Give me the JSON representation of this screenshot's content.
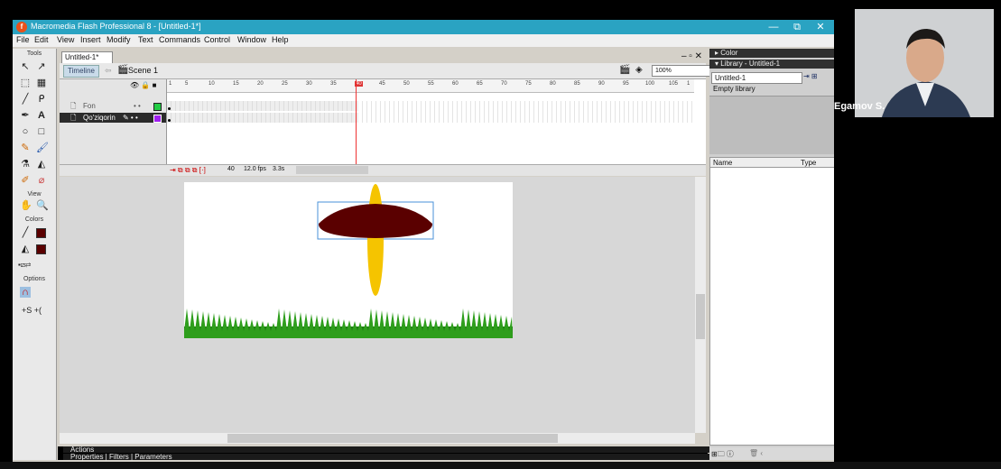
{
  "window": {
    "title": "Macromedia Flash Professional 8 - [Untitled-1*]",
    "controls": [
      "—",
      "⧉",
      "✕"
    ]
  },
  "menu": [
    "File",
    "Edit",
    "View",
    "Insert",
    "Modify",
    "Text",
    "Commands",
    "Control",
    "Window",
    "Help"
  ],
  "tools": {
    "title": "Tools",
    "view_label": "View",
    "colors_label": "Colors",
    "options_label": "Options"
  },
  "document": {
    "tab": "Untitled-1*",
    "timeline_button": "Timeline",
    "scene": "Scene 1",
    "zoom": "100%"
  },
  "timeline": {
    "frame_numbers": [
      "1",
      "5",
      "10",
      "15",
      "20",
      "25",
      "30",
      "35",
      "40",
      "45",
      "50",
      "55",
      "60",
      "65",
      "70",
      "75",
      "80",
      "85",
      "90",
      "95",
      "100",
      "105",
      "1"
    ],
    "layers": [
      {
        "name": "Fon",
        "color": "#22cc44",
        "selected": false
      },
      {
        "name": "Qo'ziqorin",
        "color": "#a020f0",
        "selected": true
      }
    ],
    "current_frame": "40",
    "fps": "12.0 fps",
    "time": "3.3s"
  },
  "panels": {
    "actions": "Actions",
    "properties": "Properties | Filters | Parameters",
    "color": "Color",
    "library": "Library - Untitled-1",
    "library_doc": "Untitled-1",
    "library_status": "Empty library",
    "col_name": "Name",
    "col_type": "Type"
  },
  "stage": {
    "cap_color": "#5a0000",
    "stem_color": "#f5c400",
    "grass_color": "#2e9e1c"
  },
  "webcam": {
    "name": "Egamov S."
  }
}
